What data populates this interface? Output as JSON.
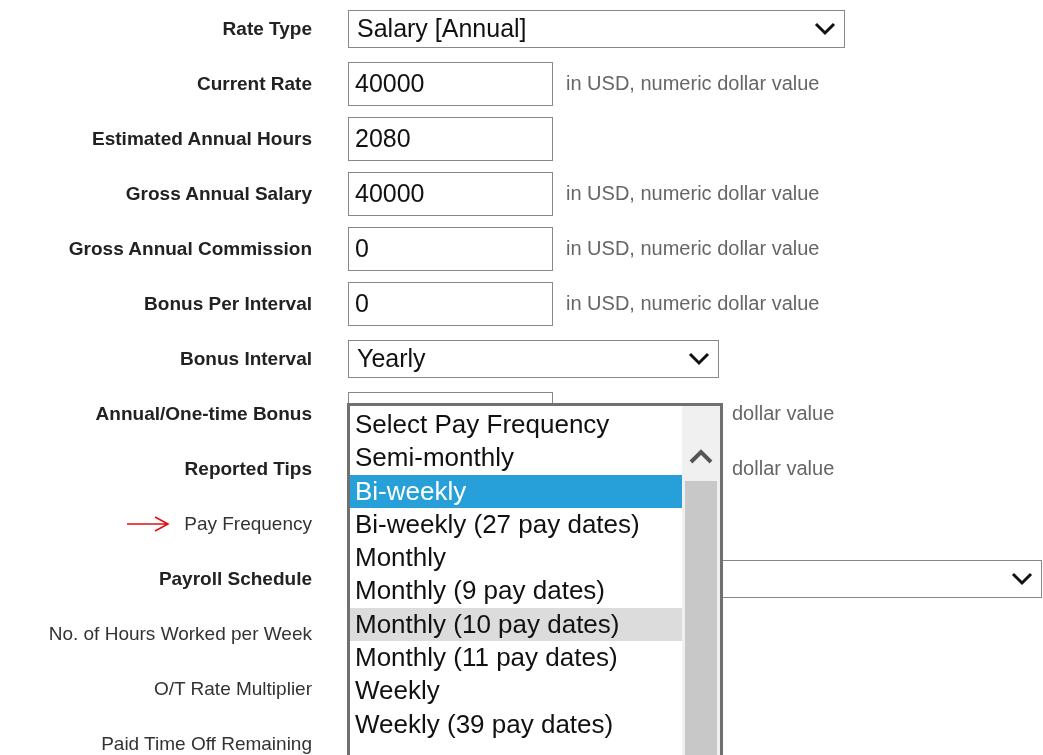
{
  "form_rows": [
    {
      "label": "Rate Type",
      "bold": true,
      "kind": "select",
      "value": "Salary [Annual]"
    },
    {
      "label": "Current Rate",
      "bold": true,
      "kind": "input",
      "value": "40000",
      "hint": "in USD, numeric dollar value"
    },
    {
      "label": "Estimated Annual Hours",
      "bold": true,
      "kind": "input",
      "value": "2080"
    },
    {
      "label": "Gross Annual Salary",
      "bold": true,
      "kind": "input",
      "value": "40000",
      "hint": "in USD, numeric dollar value"
    },
    {
      "label": "Gross Annual Commission",
      "bold": true,
      "kind": "input",
      "value": "0",
      "hint": "in USD, numeric dollar value"
    },
    {
      "label": "Bonus Per Interval",
      "bold": true,
      "kind": "input",
      "value": "0",
      "hint": "in USD, numeric dollar value"
    },
    {
      "label": "Bonus Interval",
      "bold": true,
      "kind": "select",
      "value": "Yearly"
    },
    {
      "label": "Annual/One-time Bonus",
      "bold": true,
      "kind": "input",
      "hint": "dollar value",
      "hint_covered": true
    },
    {
      "label": "Reported Tips",
      "bold": true,
      "kind": "none",
      "hint": "dollar value",
      "hint_covered": true
    },
    {
      "label": "Pay Frequency",
      "bold": false,
      "pointer": true,
      "kind": "none"
    },
    {
      "label": "Payroll Schedule",
      "bold": true,
      "kind": "select"
    },
    {
      "label": "No. of Hours Worked per Week",
      "bold": false,
      "kind": "none"
    },
    {
      "label": "O/T Rate Multiplier",
      "bold": false,
      "kind": "none"
    },
    {
      "label": "Paid Time Off Remaining",
      "bold": false,
      "kind": "none"
    }
  ],
  "pay_frequency_list": [
    {
      "label": "Select Pay Frequency",
      "selected": false,
      "hovered": false
    },
    {
      "label": "Semi-monthly",
      "selected": false,
      "hovered": false
    },
    {
      "label": "Bi-weekly",
      "selected": true,
      "hovered": false
    },
    {
      "label": "Bi-weekly (27 pay dates)",
      "selected": false,
      "hovered": false
    },
    {
      "label": "Monthly",
      "selected": false,
      "hovered": false
    },
    {
      "label": "Monthly (9 pay dates)",
      "selected": false,
      "hovered": false
    },
    {
      "label": "Monthly (10 pay dates)",
      "selected": false,
      "hovered": true
    },
    {
      "label": "Monthly (11 pay dates)",
      "selected": false,
      "hovered": false
    },
    {
      "label": "Weekly",
      "selected": false,
      "hovered": false
    },
    {
      "label": "Weekly (39 pay dates)",
      "selected": false,
      "hovered": false
    }
  ]
}
